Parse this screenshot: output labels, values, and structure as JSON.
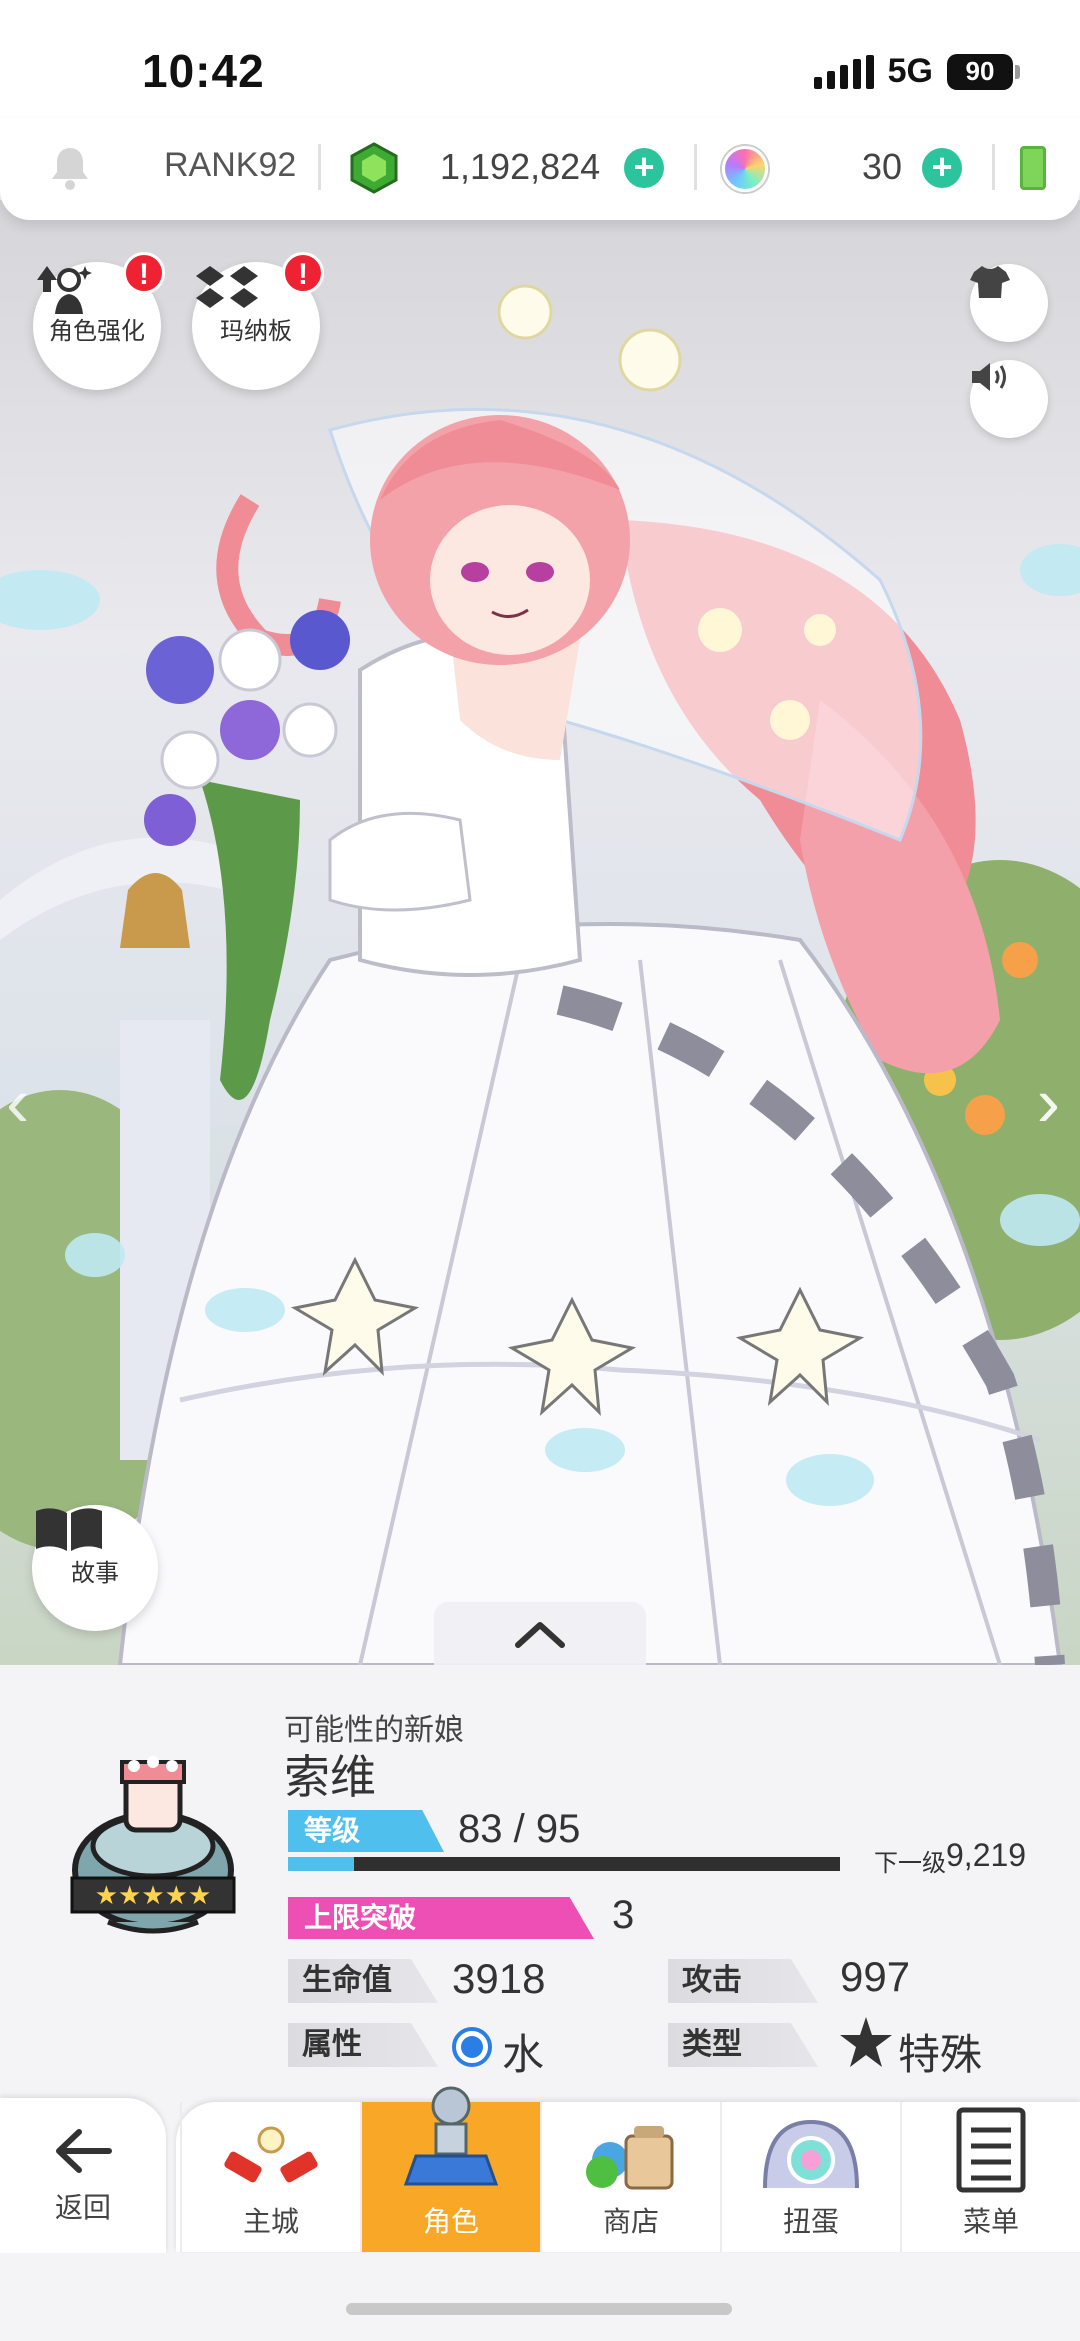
{
  "status_bar": {
    "time": "10:42",
    "network": "5G",
    "battery": "90"
  },
  "resources": {
    "rank": "RANK92",
    "gems": "1,192,824",
    "orbs": "30"
  },
  "art_buttons": {
    "enhance_label": "角色强化",
    "enhance_badge": "!",
    "mana_board_label": "玛纳板",
    "mana_board_badge": "!",
    "story_label": "故事"
  },
  "character": {
    "subtitle": "可能性的新娘",
    "name": "索维",
    "level_label": "等级",
    "level_value": "83 / 95",
    "xp_progress": 0.12,
    "next_label": "下一级",
    "next_value": "9,219",
    "limit_break_label": "上限突破",
    "limit_break_value": "3",
    "hp_label": "生命值",
    "hp_value": "3918",
    "attack_label": "攻击",
    "attack_value": "997",
    "attribute_label": "属性",
    "attribute_value": "水",
    "type_label": "类型",
    "type_value": "特殊"
  },
  "nav": {
    "back": "返回",
    "items": [
      {
        "label": "主城"
      },
      {
        "label": "角色"
      },
      {
        "label": "商店"
      },
      {
        "label": "扭蛋"
      },
      {
        "label": "菜单"
      }
    ],
    "active_index": 1
  },
  "colors": {
    "accent": "#f8a826",
    "level_tag": "#4fc0ee",
    "limit_tag": "#ee4fb4",
    "plus": "#2cc49c"
  }
}
